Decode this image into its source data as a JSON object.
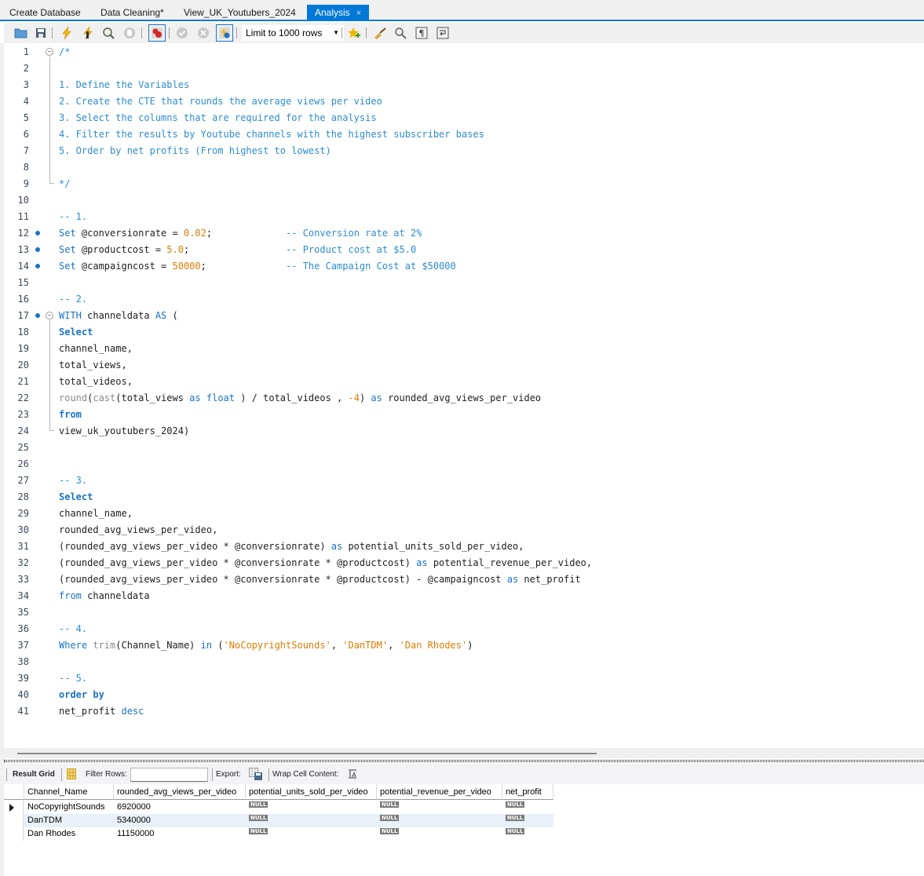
{
  "tabs": [
    {
      "label": "Create Database",
      "active": false
    },
    {
      "label": "Data Cleaning*",
      "active": false
    },
    {
      "label": "View_UK_Youtubers_2024",
      "active": false
    },
    {
      "label": "Analysis",
      "active": true,
      "close": "×"
    }
  ],
  "toolbar": {
    "icons": [
      "open-folder-icon",
      "save-icon",
      "execute-icon",
      "execute-current-icon",
      "explain-icon",
      "stop-icon",
      "toggle-stop-on-error-icon",
      "commit-icon",
      "rollback-icon",
      "autocommit-icon",
      "add-snippet-icon",
      "beautify-icon",
      "find-icon",
      "invisible-chars-icon",
      "wrap-icon"
    ],
    "limit_label": "Limit to 1000 rows"
  },
  "editor": {
    "lines": [
      {
        "n": "1",
        "fold": "start",
        "tokens": [
          [
            "cm",
            "/*"
          ]
        ]
      },
      {
        "n": "2",
        "tokens": []
      },
      {
        "n": "3",
        "tokens": [
          [
            "cm",
            "1. Define the Variables"
          ]
        ]
      },
      {
        "n": "4",
        "tokens": [
          [
            "cm",
            "2. Create the CTE that rounds the average views per video"
          ]
        ]
      },
      {
        "n": "5",
        "tokens": [
          [
            "cm",
            "3. Select the columns that are required for the analysis"
          ]
        ]
      },
      {
        "n": "6",
        "tokens": [
          [
            "cm",
            "4. Filter the results by Youtube channels with the highest subscriber bases"
          ]
        ]
      },
      {
        "n": "7",
        "tokens": [
          [
            "cm",
            "5. Order by net profits (From highest to lowest)"
          ]
        ]
      },
      {
        "n": "8",
        "tokens": []
      },
      {
        "n": "9",
        "fold": "end",
        "tokens": [
          [
            "cm",
            "*/"
          ]
        ]
      },
      {
        "n": "10",
        "tokens": []
      },
      {
        "n": "11",
        "tokens": [
          [
            "cm",
            "-- 1."
          ]
        ]
      },
      {
        "n": "12",
        "dot": true,
        "tokens": [
          [
            "kwn",
            "Set"
          ],
          [
            "",
            " @conversionrate = "
          ],
          [
            "num",
            "0.02"
          ],
          [
            "",
            ";             "
          ],
          [
            "cm",
            "-- Conversion rate at 2%"
          ]
        ]
      },
      {
        "n": "13",
        "dot": true,
        "tokens": [
          [
            "kwn",
            "Set"
          ],
          [
            "",
            " @productcost = "
          ],
          [
            "num",
            "5.0"
          ],
          [
            "",
            ";                 "
          ],
          [
            "cm",
            "-- Product cost at $5.0"
          ]
        ]
      },
      {
        "n": "14",
        "dot": true,
        "tokens": [
          [
            "kwn",
            "Set"
          ],
          [
            "",
            " @campaigncost = "
          ],
          [
            "num",
            "50000"
          ],
          [
            "",
            ";              "
          ],
          [
            "cm",
            "-- The Campaign Cost at $50000"
          ]
        ]
      },
      {
        "n": "15",
        "tokens": []
      },
      {
        "n": "16",
        "tokens": [
          [
            "cm",
            "-- 2."
          ]
        ]
      },
      {
        "n": "17",
        "dot": true,
        "fold": "start",
        "tokens": [
          [
            "kwn",
            "WITH"
          ],
          [
            "",
            " channeldata "
          ],
          [
            "kwn",
            "AS"
          ],
          [
            "",
            " ("
          ]
        ]
      },
      {
        "n": "18",
        "tokens": [
          [
            "kw",
            "Select"
          ]
        ]
      },
      {
        "n": "19",
        "tokens": [
          [
            "",
            "channel_name,"
          ]
        ]
      },
      {
        "n": "20",
        "tokens": [
          [
            "",
            "total_views,"
          ]
        ]
      },
      {
        "n": "21",
        "tokens": [
          [
            "",
            "total_videos,"
          ]
        ]
      },
      {
        "n": "22",
        "tokens": [
          [
            "fn",
            "round"
          ],
          [
            "",
            "("
          ],
          [
            "fn",
            "cast"
          ],
          [
            "",
            "(total_views "
          ],
          [
            "kwn",
            "as"
          ],
          [
            "",
            " "
          ],
          [
            "kwn",
            "float"
          ],
          [
            "",
            " ) / total_videos , "
          ],
          [
            "num",
            "-4"
          ],
          [
            "",
            ") "
          ],
          [
            "kwn",
            "as"
          ],
          [
            "",
            " rounded_avg_views_per_video"
          ]
        ]
      },
      {
        "n": "23",
        "tokens": [
          [
            "kw",
            "from"
          ]
        ]
      },
      {
        "n": "24",
        "fold": "end",
        "tokens": [
          [
            "",
            "view_uk_youtubers_2024)"
          ]
        ]
      },
      {
        "n": "25",
        "tokens": []
      },
      {
        "n": "26",
        "tokens": []
      },
      {
        "n": "27",
        "tokens": [
          [
            "cm",
            "-- 3."
          ]
        ]
      },
      {
        "n": "28",
        "tokens": [
          [
            "kw",
            "Select"
          ]
        ]
      },
      {
        "n": "29",
        "tokens": [
          [
            "",
            "channel_name,"
          ]
        ]
      },
      {
        "n": "30",
        "tokens": [
          [
            "",
            "rounded_avg_views_per_video,"
          ]
        ]
      },
      {
        "n": "31",
        "tokens": [
          [
            "",
            "(rounded_avg_views_per_video * @conversionrate) "
          ],
          [
            "kwn",
            "as"
          ],
          [
            "",
            " potential_units_sold_per_video,"
          ]
        ]
      },
      {
        "n": "32",
        "tokens": [
          [
            "",
            "(rounded_avg_views_per_video * @conversionrate * @productcost) "
          ],
          [
            "kwn",
            "as"
          ],
          [
            "",
            " potential_revenue_per_video,"
          ]
        ]
      },
      {
        "n": "33",
        "tokens": [
          [
            "",
            "(rounded_avg_views_per_video * @conversionrate * @productcost) - @campaigncost "
          ],
          [
            "kwn",
            "as"
          ],
          [
            "",
            " net_profit"
          ]
        ]
      },
      {
        "n": "34",
        "tokens": [
          [
            "kwn",
            "from"
          ],
          [
            "",
            " channeldata"
          ]
        ]
      },
      {
        "n": "35",
        "tokens": []
      },
      {
        "n": "36",
        "tokens": [
          [
            "cm",
            "-- 4."
          ]
        ]
      },
      {
        "n": "37",
        "tokens": [
          [
            "kwn",
            "Where"
          ],
          [
            "",
            " "
          ],
          [
            "fn",
            "trim"
          ],
          [
            "",
            "(Channel_Name) "
          ],
          [
            "kwn",
            "in"
          ],
          [
            "",
            " ("
          ],
          [
            "str",
            "'NoCopyrightSounds'"
          ],
          [
            "",
            ", "
          ],
          [
            "str",
            "'DanTDM'"
          ],
          [
            "",
            ", "
          ],
          [
            "str",
            "'Dan Rhodes'"
          ],
          [
            "",
            ")"
          ]
        ]
      },
      {
        "n": "38",
        "tokens": []
      },
      {
        "n": "39",
        "tokens": [
          [
            "cm",
            "-- 5."
          ]
        ]
      },
      {
        "n": "40",
        "tokens": [
          [
            "kw",
            "order by"
          ]
        ]
      },
      {
        "n": "41",
        "tokens": [
          [
            "",
            "net_profit "
          ],
          [
            "kwn",
            "desc"
          ]
        ]
      }
    ]
  },
  "results": {
    "toolbar": {
      "result_grid_label": "Result Grid",
      "filter_rows_label": "Filter Rows:",
      "filter_rows_value": "",
      "export_label": "Export:",
      "wrap_label": "Wrap Cell Content:"
    },
    "columns": [
      "Channel_Name",
      "rounded_avg_views_per_video",
      "potential_units_sold_per_video",
      "potential_revenue_per_video",
      "net_profit"
    ],
    "rows": [
      [
        "NoCopyrightSounds",
        "6920000",
        "NULL",
        "NULL",
        "NULL"
      ],
      [
        "DanTDM",
        "5340000",
        "NULL",
        "NULL",
        "NULL"
      ],
      [
        "Dan Rhodes",
        "11150000",
        "NULL",
        "NULL",
        "NULL"
      ]
    ],
    "null_label": "NULL"
  }
}
